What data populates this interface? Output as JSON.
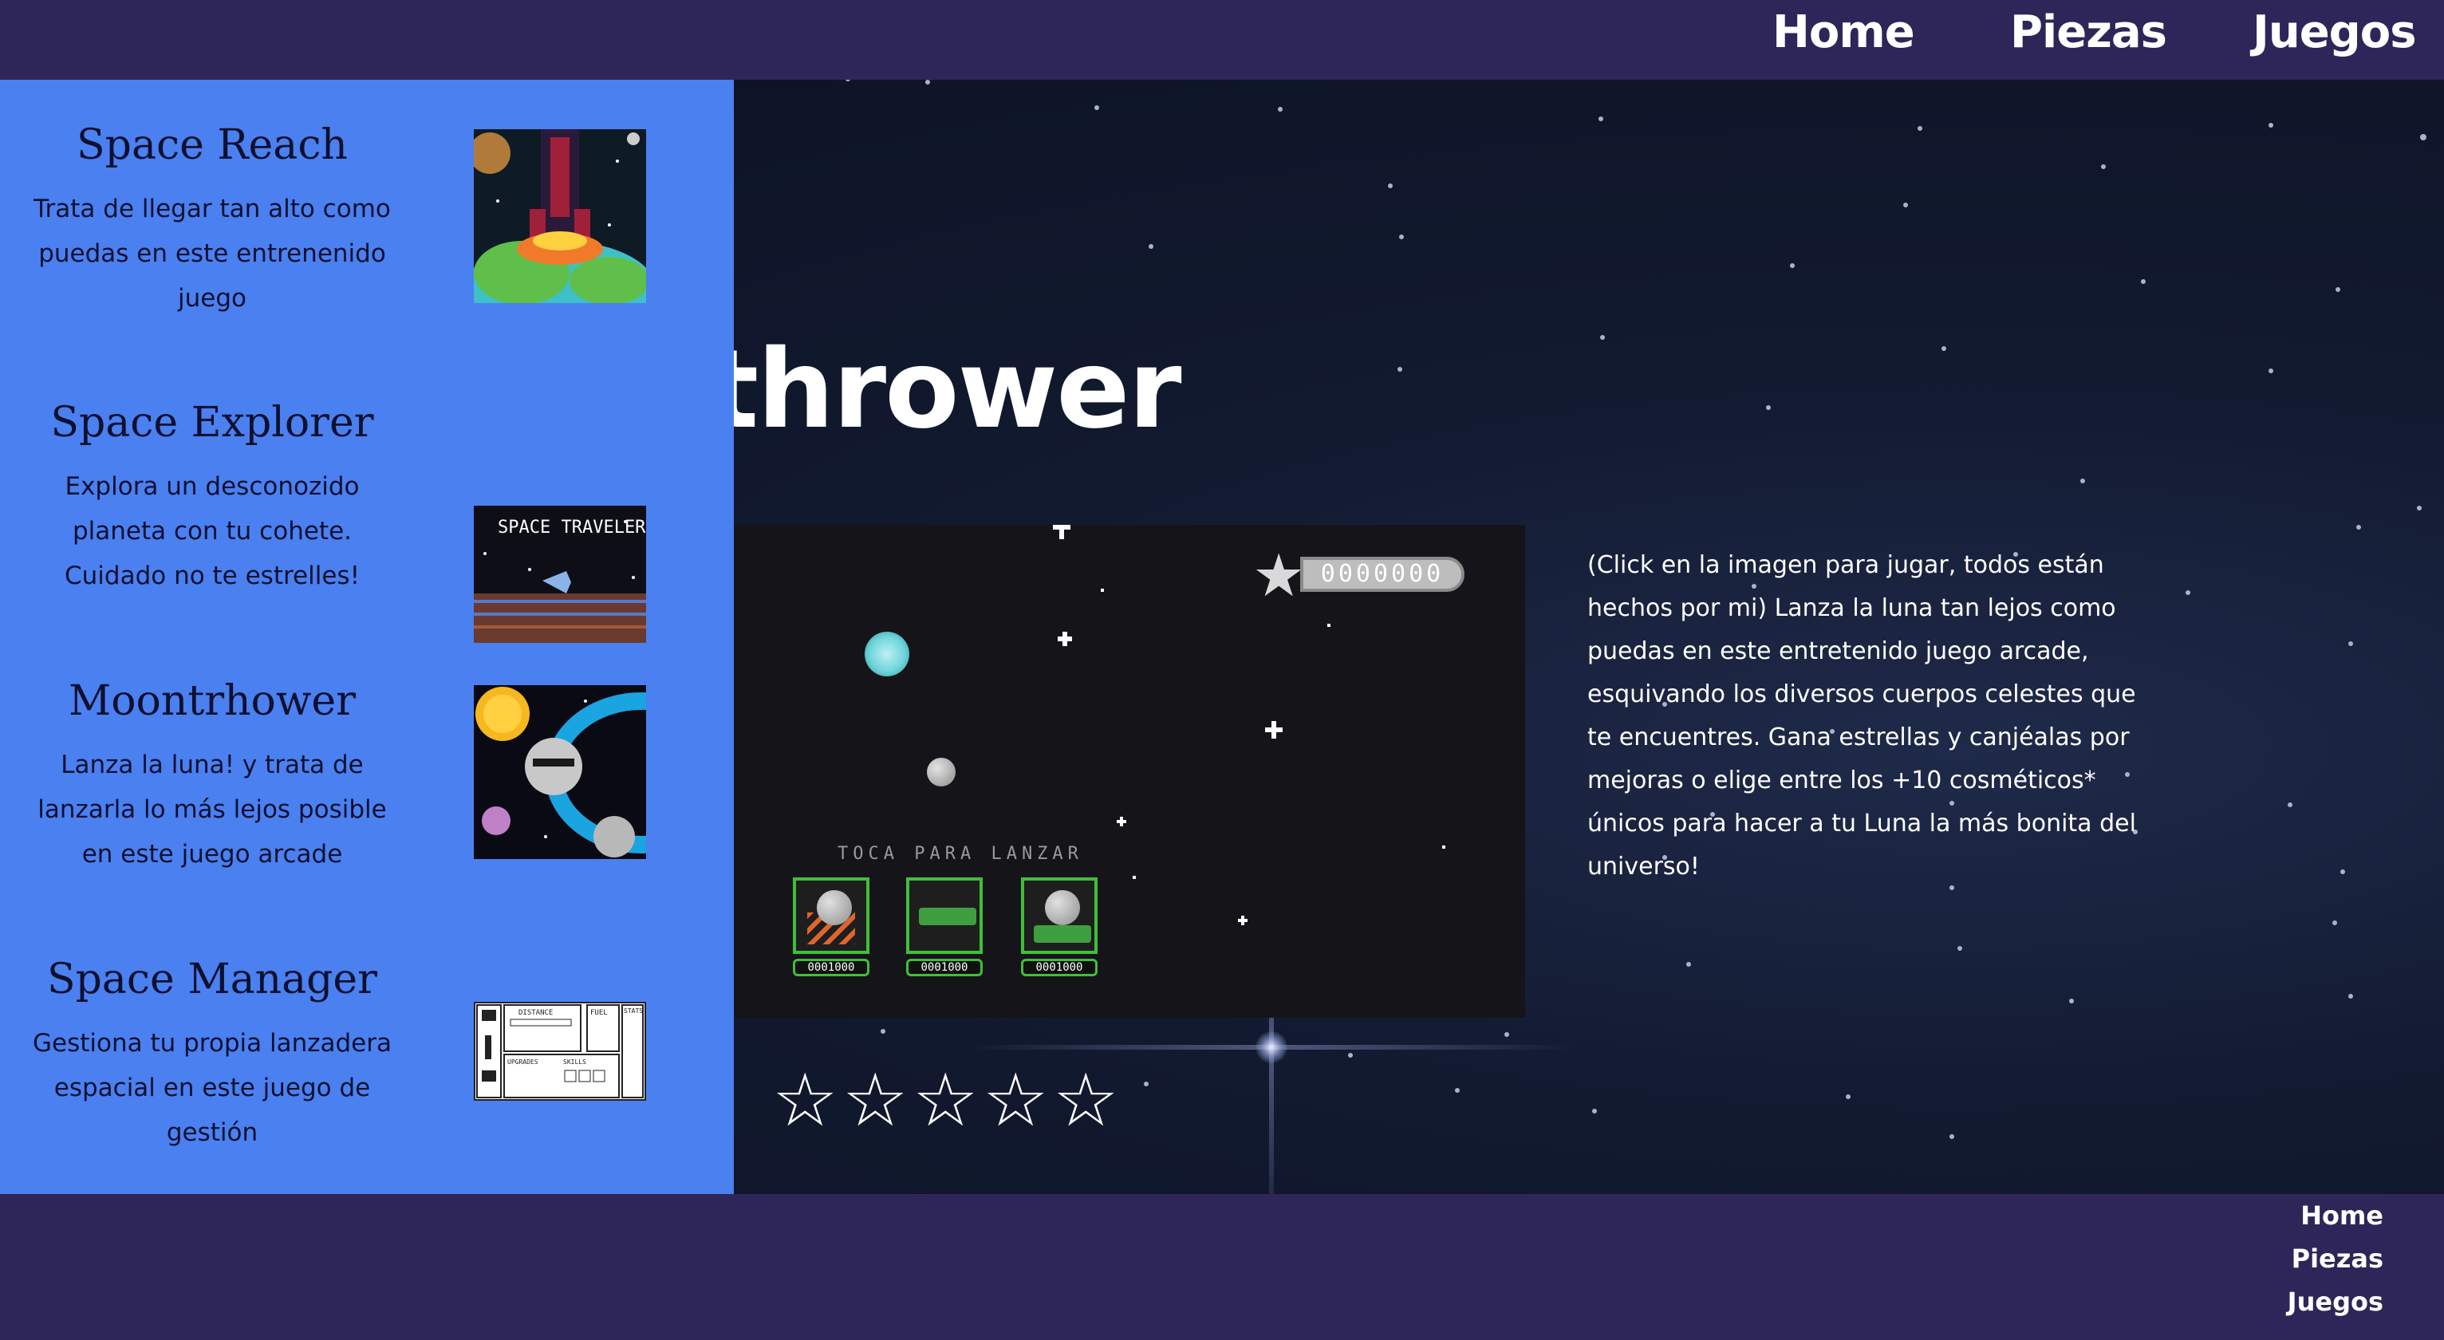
{
  "nav": {
    "home": "Home",
    "piezas": "Piezas",
    "juegos": "Juegos"
  },
  "main": {
    "title": "onthrower",
    "score": "0000000",
    "tap_label": "TOCA PARA LANZAR",
    "upgrade_prices": [
      "0001000",
      "0001000",
      "0001000"
    ],
    "rating": {
      "stars_total": 5,
      "stars_filled": 0,
      "glyph": "☆"
    },
    "description": "(Click en la imagen para jugar, todos están hechos por mi) Lanza la luna tan lejos como puedas en este entretenido juego arcade, esquivando los diversos cuerpos celestes que te encuentres. Gana estrellas y canjéalas por mejoras o elige entre los +10 cosméticos* únicos para hacer a tu Luna la más bonita del universo!"
  },
  "sidebar": {
    "items": [
      {
        "name": "Space Reach",
        "desc": "Trata de llegar tan alto como puedas en este entrenenido juego",
        "thumb_icon": "rocket-pixel-icon"
      },
      {
        "name": "Space Explorer",
        "desc": "Explora un desconozido planeta con tu cohete. Cuidado no te estrelles!",
        "thumb_label": "SPACE TRAVELER",
        "thumb_icon": "spaceship-pixel-icon"
      },
      {
        "name": "Moontrhower",
        "desc": "Lanza la luna! y trata de lanzarla lo más lejos posible en este juego arcade",
        "thumb_icon": "moon-pixel-icon"
      },
      {
        "name": "Space Manager",
        "desc": "Gestiona tu propia lanzadera espacial en este juego de gestión",
        "thumb_labels": [
          "DISTANCE",
          "FUEL",
          "STATS",
          "UPGRADES",
          "SKILLS"
        ],
        "thumb_icon": "manager-ui-icon"
      }
    ]
  },
  "footer": {
    "home": "Home",
    "piezas": "Piezas",
    "juegos": "Juegos"
  },
  "colors": {
    "header_bg": "#2e2658",
    "sidebar_bg": "#4a80f0",
    "accent_green": "#3fbf3a"
  }
}
